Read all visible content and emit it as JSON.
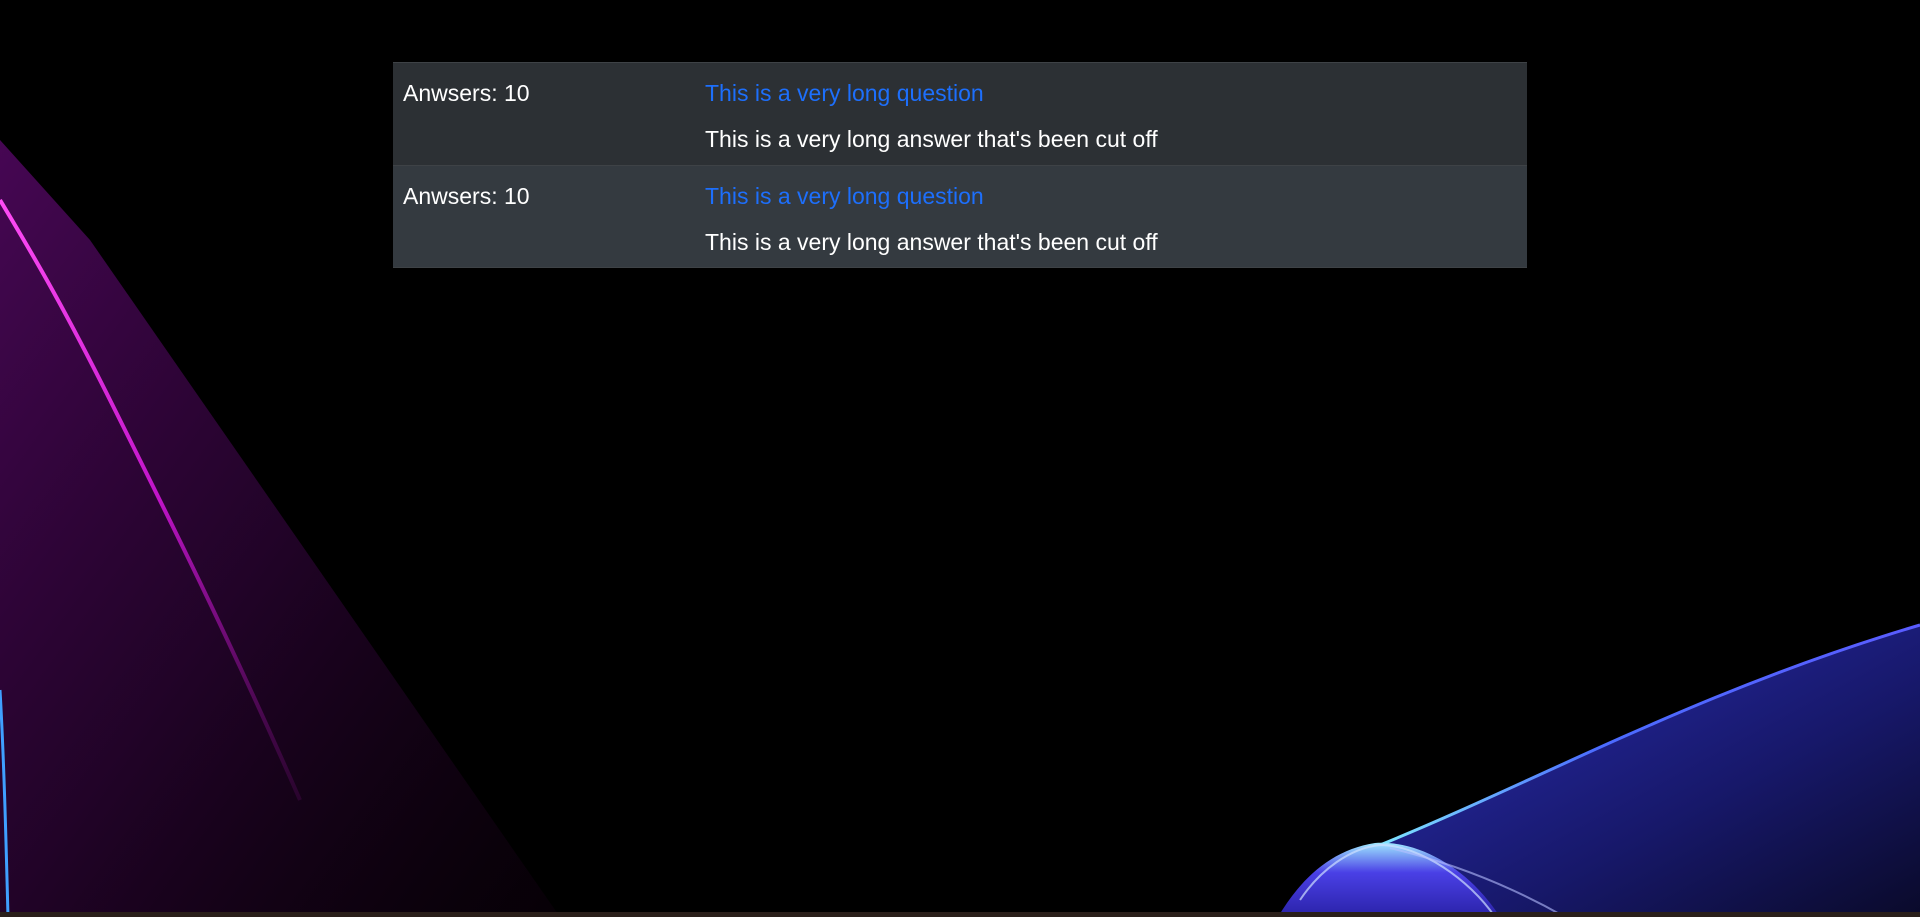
{
  "wallpaper": {
    "colors": {
      "background": "#000000",
      "left_glow": "#ff2cf0",
      "left_fade": "#3a0440",
      "right_wave": "#3e3fe0",
      "right_highlight": "#6ad7ff"
    }
  },
  "questions_table": {
    "colors": {
      "row_odd": "#2c3034",
      "row_even": "#343a40",
      "link": "#1d6ffc",
      "text": "#ffffff"
    },
    "rows": [
      {
        "answers_count": "Anwsers: 10",
        "question": "This is a very long question",
        "answer_preview": "This is a very long answer that's been cut off"
      },
      {
        "answers_count": "Anwsers: 10",
        "question": "This is a very long question",
        "answer_preview": "This is a very long answer that's been cut off"
      }
    ]
  }
}
